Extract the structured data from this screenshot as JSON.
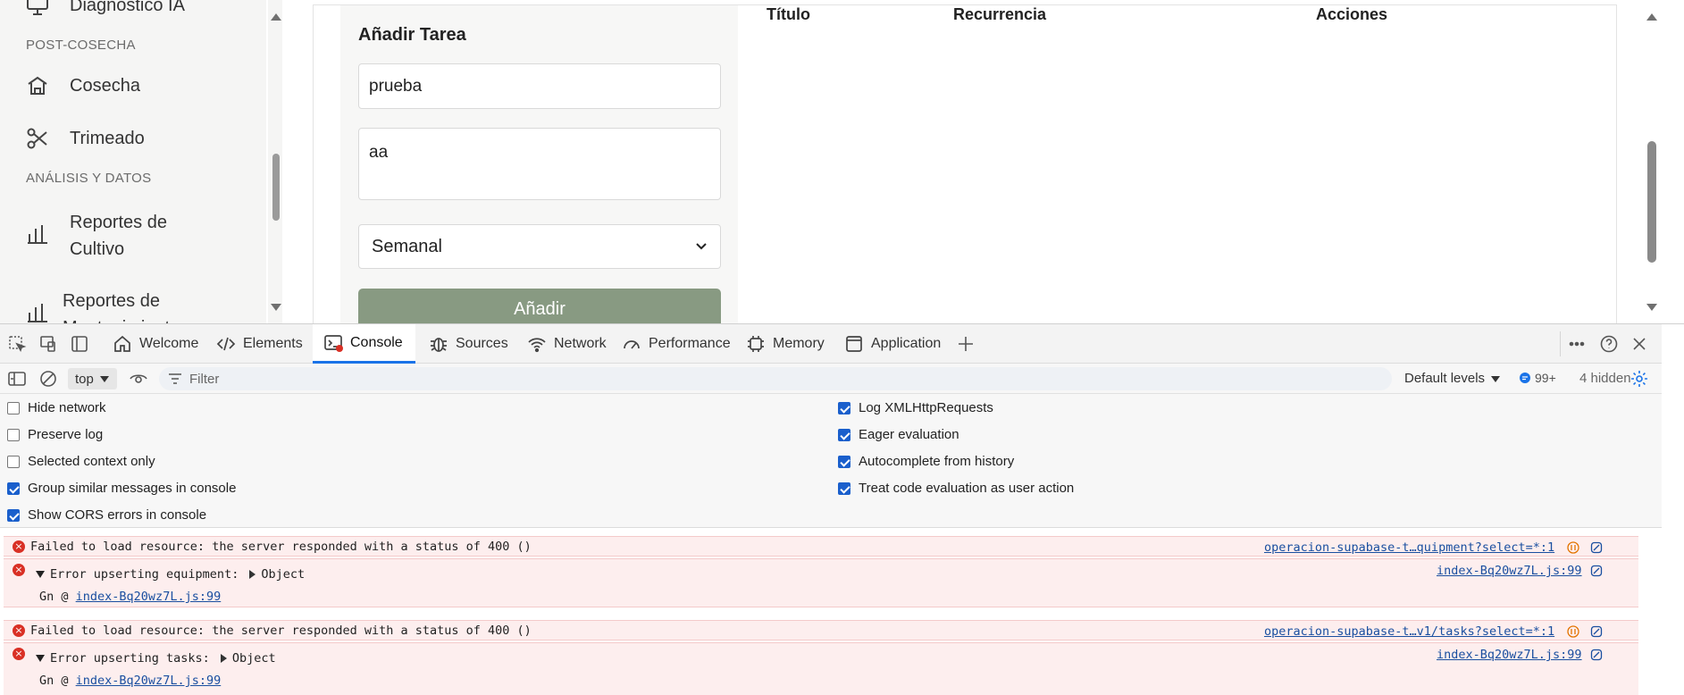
{
  "sidebar": {
    "items": [
      {
        "label": "Diagnóstico IA"
      },
      {
        "section": "POST-COSECHA"
      },
      {
        "label": "Cosecha"
      },
      {
        "label": "Trimeado"
      },
      {
        "section": "ANÁLISIS Y DATOS"
      },
      {
        "label": "Reportes de",
        "label2": "Cultivo"
      },
      {
        "label": "Reportes de",
        "label2": "Mantenimiento"
      }
    ]
  },
  "form": {
    "title": "Añadir Tarea",
    "title_value": "prueba",
    "description_value": "aa",
    "recurrence_value": "Semanal",
    "add_label": "Añadir"
  },
  "table": {
    "headers": [
      "Título",
      "Recurrencia",
      "Acciones"
    ]
  },
  "devtools": {
    "tabs": [
      {
        "label": "Welcome",
        "icon": "home-icon"
      },
      {
        "label": "Elements",
        "icon": "code-icon"
      },
      {
        "label": "Console",
        "icon": "console-icon"
      },
      {
        "label": "Sources",
        "icon": "bug-icon"
      },
      {
        "label": "Network",
        "icon": "wifi-icon"
      },
      {
        "label": "Performance",
        "icon": "gauge-icon"
      },
      {
        "label": "Memory",
        "icon": "chip-icon"
      },
      {
        "label": "Application",
        "icon": "window-icon"
      }
    ],
    "context": "top",
    "filter_placeholder": "Filter",
    "levels": "Default levels",
    "issue_count": "99+",
    "hidden_count": "4 hidden",
    "settings_left": [
      {
        "label": "Hide network",
        "checked": false
      },
      {
        "label": "Preserve log",
        "checked": false
      },
      {
        "label": "Selected context only",
        "checked": false
      },
      {
        "label": "Group similar messages in console",
        "checked": true
      },
      {
        "label": "Show CORS errors in console",
        "checked": true
      }
    ],
    "settings_right": [
      {
        "label": "Log XMLHttpRequests",
        "checked": true
      },
      {
        "label": "Eager evaluation",
        "checked": true
      },
      {
        "label": "Autocomplete from history",
        "checked": true
      },
      {
        "label": "Treat code evaluation as user action",
        "checked": true
      }
    ],
    "messages": [
      {
        "text": "Failed to load resource: the server responded with a status of 400 ()",
        "source": "operacion-supabase-t…quipment?select=*:1"
      },
      {
        "text": "Error upserting equipment:",
        "object": "Object",
        "trace_fn": "Gn @",
        "trace_link": "index-Bq20wz7L.js:99",
        "source": "index-Bq20wz7L.js:99"
      },
      {
        "text": "Failed to load resource: the server responded with a status of 400 ()",
        "source": "operacion-supabase-t…v1/tasks?select=*:1"
      },
      {
        "text": "Error upserting tasks:",
        "object": "Object",
        "trace_fn": "Gn @",
        "trace_link": "index-Bq20wz7L.js:99",
        "source": "index-Bq20wz7L.js:99"
      }
    ]
  },
  "colors": {
    "accent": "#1a73e8",
    "add_button": "#889a82",
    "error_bg": "#fdeeee",
    "error_icon": "#d93025"
  }
}
